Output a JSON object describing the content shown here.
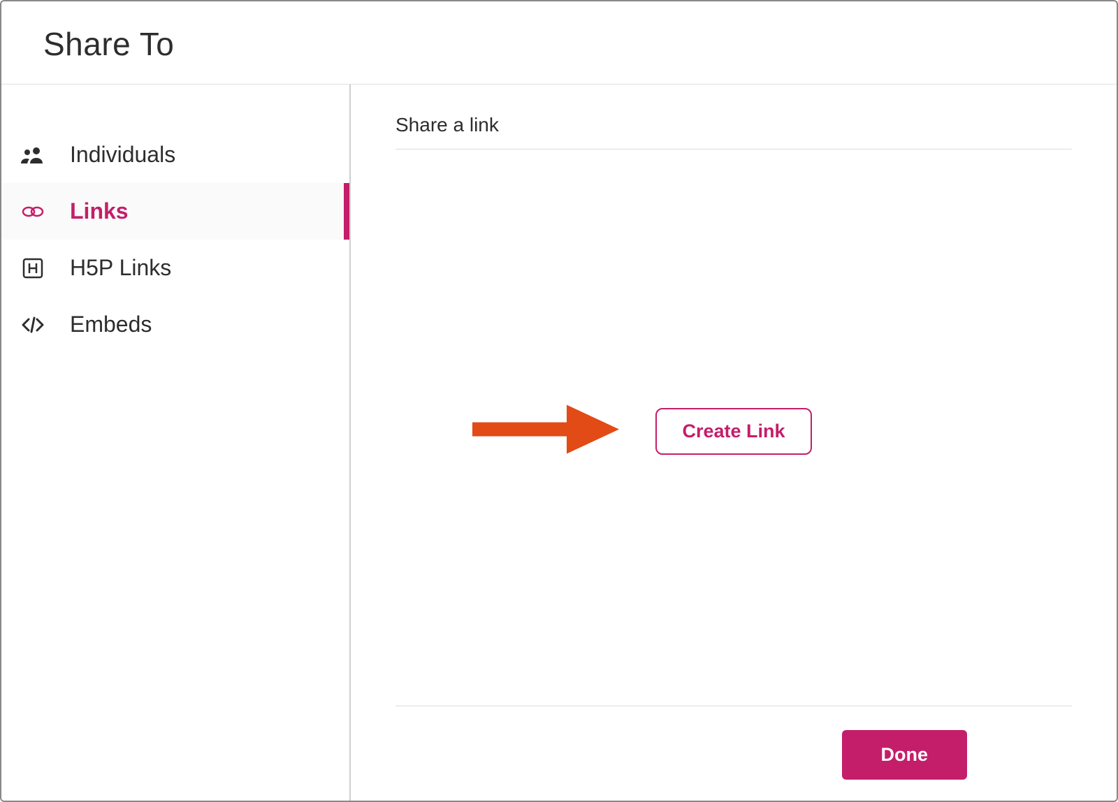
{
  "header": {
    "title": "Share To"
  },
  "sidebar": {
    "items": [
      {
        "icon": "people-icon",
        "label": "Individuals",
        "active": false
      },
      {
        "icon": "link-icon",
        "label": "Links",
        "active": true
      },
      {
        "icon": "h5p-icon",
        "label": "H5P Links",
        "active": false
      },
      {
        "icon": "code-icon",
        "label": "Embeds",
        "active": false
      }
    ]
  },
  "content": {
    "section_title": "Share a link",
    "create_link_label": "Create Link",
    "done_label": "Done"
  },
  "annotation": {
    "arrow_color": "#e24a16"
  },
  "colors": {
    "accent": "#c41e6a",
    "text": "#2d2d2d"
  }
}
